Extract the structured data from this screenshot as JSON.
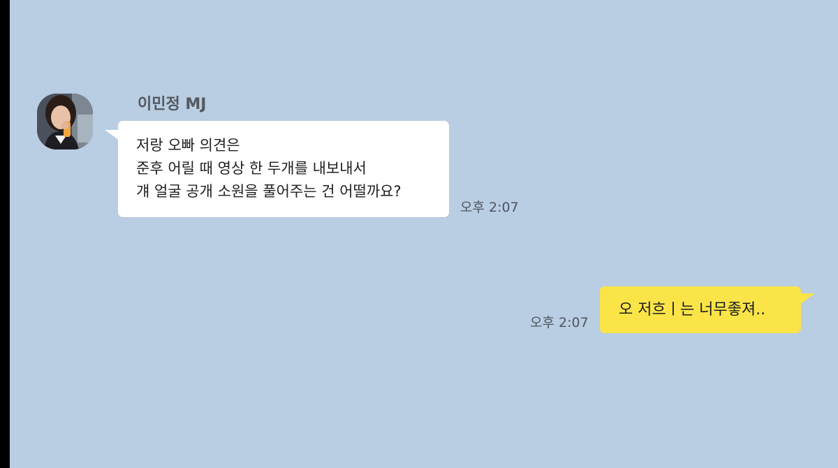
{
  "chat": {
    "background_color": "#b9cde3",
    "incoming": {
      "sender_name": "이민정 MJ",
      "avatar_icon": "profile-photo",
      "lines": [
        "저랑 오빠 의견은",
        "준후 어릴 때 영상 한 두개를 내보내서",
        "걔 얼굴 공개 소원을 풀어주는 건 어떨까요?"
      ],
      "time": "오후 2:07",
      "bubble_color": "#ffffff"
    },
    "outgoing": {
      "text": "오 저흐ㅣ는 너무좋져..",
      "time": "오후 2:07",
      "bubble_color": "#fae448"
    }
  }
}
